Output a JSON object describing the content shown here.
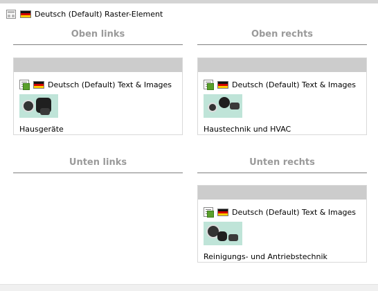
{
  "header": {
    "title": "Deutsch (Default) Raster-Element",
    "icon": "grid-layout-icon",
    "flag": "flag-de-icon"
  },
  "columns": {
    "top_left": "Oben links",
    "top_right": "Oben rechts",
    "bottom_left": "Unten links",
    "bottom_right": "Unten rechts"
  },
  "elements": [
    {
      "type_label": "Deutsch (Default) Text & Images",
      "caption": "Hausgeräte"
    },
    {
      "type_label": "Deutsch (Default) Text & Images",
      "caption": "Haustechnik und HVAC"
    },
    {
      "type_label": "Deutsch (Default) Text & Images",
      "caption": "Reinigungs- und Antriebstechnik"
    }
  ],
  "colors": {
    "column_header_text": "#9a9a9a",
    "box_header": "#cccccc"
  }
}
